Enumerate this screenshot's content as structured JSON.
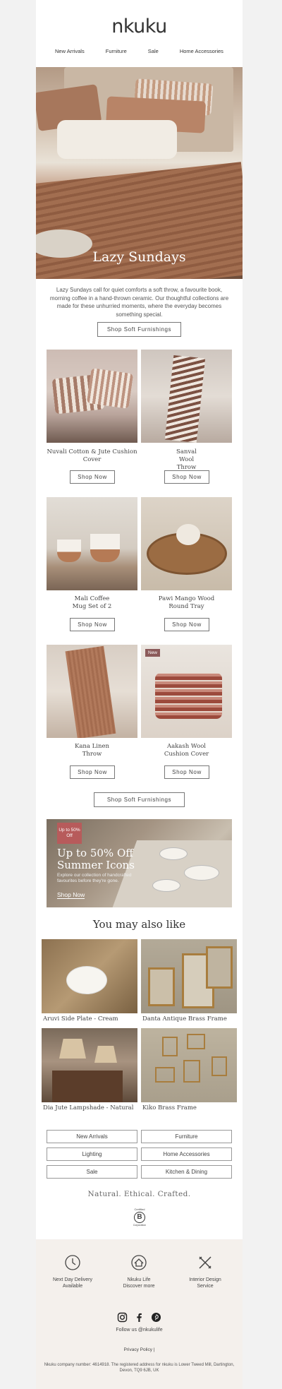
{
  "brand": {
    "logo": "nkuku"
  },
  "nav": [
    "New Arrivals",
    "Furniture",
    "Sale",
    "Home Accessories"
  ],
  "hero": {
    "title": "Lazy Sundays"
  },
  "intro": {
    "text": "Lazy Sundays call for quiet comforts a soft throw, a favourite book, morning coffee in a hand-thrown ceramic. Our thoughtful collections are made for these unhurried moments, where the everyday becomes something special."
  },
  "cta": {
    "primary": "Shop Soft Furnishings",
    "secondary": "Shop Soft Furnishings"
  },
  "products": [
    {
      "name": "Nuvali Cotton & Jute Cushion Cover",
      "button": "Shop Now"
    },
    {
      "name": "Sanval Wool Throw",
      "button": "Shop Now"
    },
    {
      "name": "Mali Coffee Mug Set of 2",
      "button": "Shop Now"
    },
    {
      "name": "Pawi Mango Wood Round Tray",
      "button": "Shop Now"
    },
    {
      "name": "Kana Linen Throw",
      "button": "Shop Now"
    },
    {
      "name": "Aakash Wool Cushion Cover",
      "button": "Shop Now",
      "badge": "New"
    }
  ],
  "banner": {
    "badge": "Up to 50% Off",
    "title": "Up to 50% Off Summer Icons",
    "subtitle": "Explore our collection of handcrafted favourites before they're gone.",
    "link": "Shop Now"
  },
  "recommendations": {
    "heading": "You may also like",
    "items": [
      {
        "name": "Aruvi Side Plate - Cream"
      },
      {
        "name": "Danta Antique Brass Frame"
      },
      {
        "name": "Dia Jute Lampshade - Natural"
      },
      {
        "name": "Kiko Brass Frame"
      }
    ]
  },
  "categories": [
    "New Arrivals",
    "Furniture",
    "Lighting",
    "Home Accessories",
    "Sale",
    "Kitchen & Dining"
  ],
  "tagline": "Natural. Ethical. Crafted.",
  "bcorp": {
    "top": "Certified",
    "letter": "B",
    "bottom": "Corporation"
  },
  "features": [
    {
      "title": "Next Day Delivery",
      "sub": "Available"
    },
    {
      "title": "Nkuku Life",
      "sub": "Discover more"
    },
    {
      "title": "Interior Design",
      "sub": "Service"
    }
  ],
  "social": {
    "follow": "Follow us @nkukulife",
    "icons": [
      "instagram-icon",
      "facebook-icon",
      "pinterest-icon"
    ]
  },
  "footer": {
    "links": "Privacy Policy  |",
    "legal": "Nkuku company number: 4614918. The registered address for nkuku is Lower Tweed Mill, Dartington, Devon, TQ9 6JB, UK"
  },
  "colors": {
    "accent": "#b75b5b",
    "footer_bg": "#f4f0ec",
    "badge_new": "#8b5a5a"
  }
}
